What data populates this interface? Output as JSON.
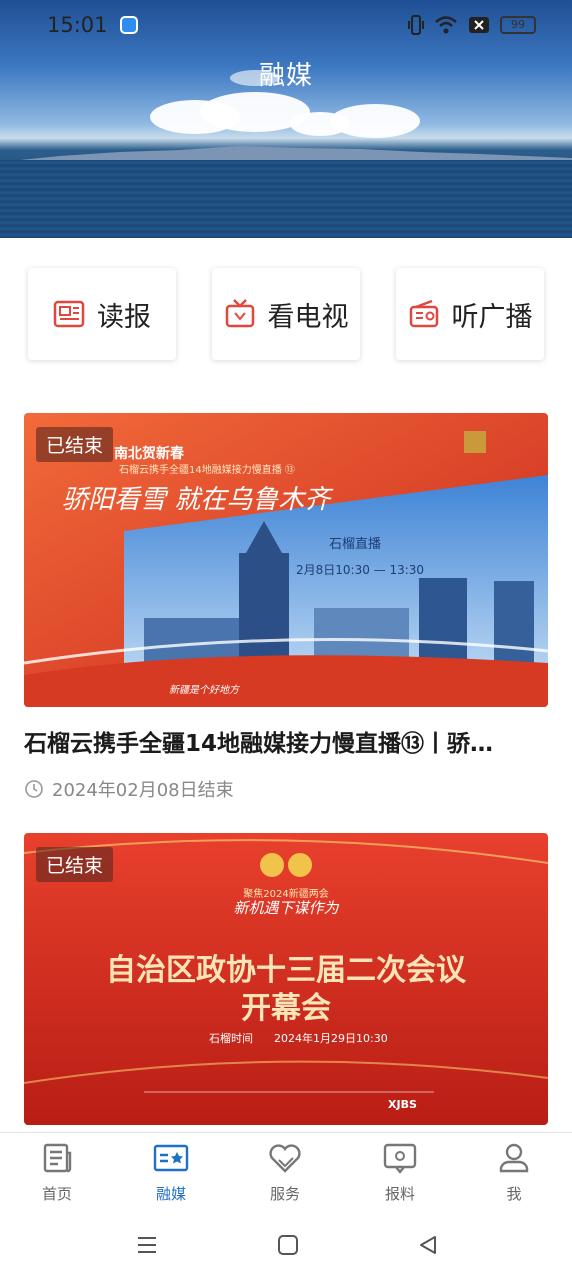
{
  "status": {
    "time": "15:01",
    "battery": "99"
  },
  "header": {
    "title": "融媒"
  },
  "quick": [
    {
      "label": "读报",
      "icon": "newspaper-icon"
    },
    {
      "label": "看电视",
      "icon": "tv-icon"
    },
    {
      "label": "听广播",
      "icon": "radio-icon"
    }
  ],
  "cards": [
    {
      "badge": "已结束",
      "title": "石榴云携手全疆14地融媒接力慢直播⑬丨骄…",
      "meta": "2024年02月08日结束",
      "poster": {
        "top": "南北贺新春",
        "sub": "石榴云携手全疆14地融媒接力慢直播 ⑬",
        "calli": "骄阳看雪 就在乌鲁木齐",
        "logo": "石榴直播",
        "time": "2月8日10:30 — 13:30",
        "foot": "新疆是个好地方"
      }
    },
    {
      "badge": "已结束",
      "poster": {
        "top": "聚焦2024新疆两会",
        "slogan": "新机遇下谋作为",
        "line1": "自治区政协十三届二次会议",
        "line2": "开幕会",
        "time_label": "石榴时间",
        "time": "2024年1月29日10:30",
        "brand": "XJBS"
      }
    }
  ],
  "tabs": [
    {
      "label": "首页",
      "icon": "home-news-icon",
      "active": false
    },
    {
      "label": "融媒",
      "icon": "media-icon",
      "active": true
    },
    {
      "label": "服务",
      "icon": "heart-service-icon",
      "active": false
    },
    {
      "label": "报料",
      "icon": "report-chat-icon",
      "active": false
    },
    {
      "label": "我",
      "icon": "user-icon",
      "active": false
    }
  ],
  "colors": {
    "accent": "#1f6fc7",
    "quick_icon": "#e0473e",
    "poster_red": "#c8261c"
  }
}
